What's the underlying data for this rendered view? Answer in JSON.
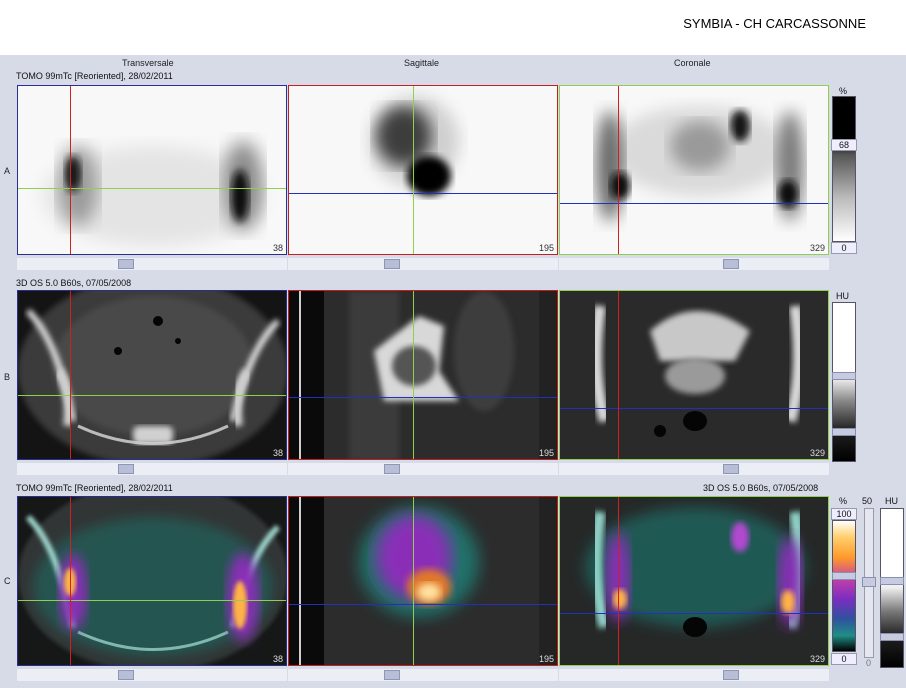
{
  "header": {
    "title": "SYMBIA - CH CARCASSONNE"
  },
  "columns": {
    "transverse": "Transversale",
    "sagittal": "Sagittale",
    "coronal": "Coronale"
  },
  "rows": {
    "a": {
      "label": "A",
      "info": "TOMO 99mTc [Reoriented], 28/02/2011"
    },
    "b": {
      "label": "B",
      "info": "3D OS 5.0 B60s, 07/05/2008"
    },
    "c": {
      "label": "C",
      "info_left": "TOMO 99mTc [Reoriented], 28/02/2011",
      "info_right": "3D OS 5.0 B60s, 07/05/2008"
    }
  },
  "slices": {
    "transverse": "38",
    "sagittal": "195",
    "coronal": "329"
  },
  "colorbars": {
    "a": {
      "unit": "%",
      "max": "68",
      "min": "0"
    },
    "b": {
      "unit": "HU"
    },
    "c": {
      "unit_left": "%",
      "max_left": "100",
      "min_left": "0",
      "mid": "50",
      "unit_right": "HU",
      "min_mid": "0"
    }
  },
  "colors": {
    "transverse_border": "#2a2f8f",
    "sagittal_border": "#c02020",
    "coronal_border": "#8fd14f",
    "crosshair_red": "#d02020",
    "crosshair_green": "#8fd14f",
    "crosshair_blue": "#2030c0"
  }
}
